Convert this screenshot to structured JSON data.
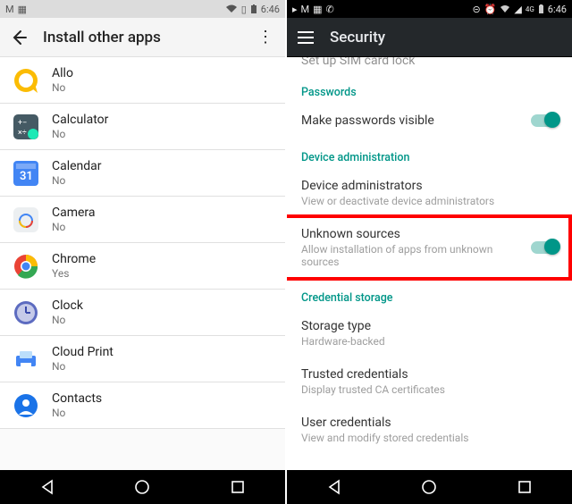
{
  "left": {
    "status": {
      "time": "6:46"
    },
    "appbar": {
      "title": "Install other apps"
    },
    "apps": [
      {
        "id": "allo",
        "label": "Allo",
        "sub": "No"
      },
      {
        "id": "calculator",
        "label": "Calculator",
        "sub": "No"
      },
      {
        "id": "calendar",
        "label": "Calendar",
        "sub": "No"
      },
      {
        "id": "camera",
        "label": "Camera",
        "sub": "No"
      },
      {
        "id": "chrome",
        "label": "Chrome",
        "sub": "Yes"
      },
      {
        "id": "clock",
        "label": "Clock",
        "sub": "No"
      },
      {
        "id": "cloudprint",
        "label": "Cloud Print",
        "sub": "No"
      },
      {
        "id": "contacts",
        "label": "Contacts",
        "sub": "No"
      }
    ]
  },
  "right": {
    "status": {
      "net": "4G",
      "time": "6:46"
    },
    "appbar": {
      "title": "Security"
    },
    "cutoff_top": "Set up SIM card lock",
    "sections": {
      "passwords": {
        "header": "Passwords",
        "row": {
          "title": "Make passwords visible",
          "toggled": true
        }
      },
      "device_admin": {
        "header": "Device administration",
        "rows": [
          {
            "title": "Device administrators",
            "sub": "View or deactivate device administrators"
          },
          {
            "title": "Unknown sources",
            "sub": "Allow installation of apps from unknown sources",
            "toggled": true,
            "highlighted": true
          }
        ]
      },
      "cred": {
        "header": "Credential storage",
        "rows": [
          {
            "title": "Storage type",
            "sub": "Hardware-backed"
          },
          {
            "title": "Trusted credentials",
            "sub": "Display trusted CA certificates"
          },
          {
            "title": "User credentials",
            "sub": "View and modify stored credentials"
          }
        ]
      }
    }
  }
}
